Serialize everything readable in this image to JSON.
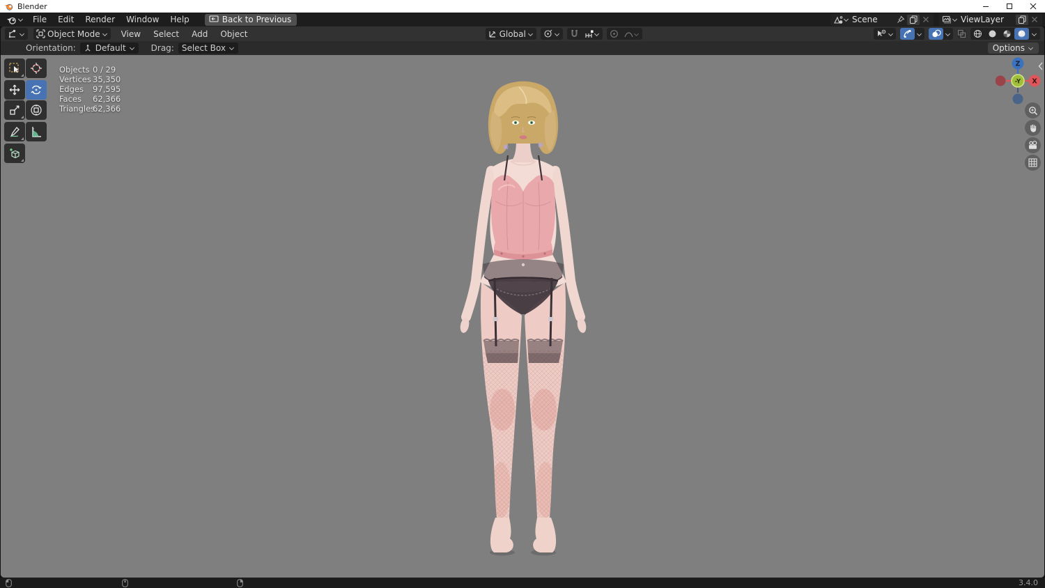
{
  "titlebar": {
    "title": "Blender"
  },
  "topbar": {
    "menus": [
      "File",
      "Edit",
      "Render",
      "Window",
      "Help"
    ],
    "back_button": "Back to Previous",
    "scene": {
      "value": "Scene"
    },
    "viewlayer": {
      "value": "ViewLayer"
    }
  },
  "viewport_header": {
    "mode": "Object Mode",
    "menus": [
      "View",
      "Select",
      "Add",
      "Object"
    ],
    "orientation": "Global"
  },
  "tool_settings": {
    "orientation_label": "Orientation:",
    "orientation_value": "Default",
    "drag_label": "Drag:",
    "drag_value": "Select Box",
    "options": "Options"
  },
  "stats": {
    "rows": [
      {
        "label": "Objects",
        "value": "0 / 29"
      },
      {
        "label": "Vertices",
        "value": "35,350"
      },
      {
        "label": "Edges",
        "value": "97,595"
      },
      {
        "label": "Faces",
        "value": "62,366"
      },
      {
        "label": "Triangles",
        "value": "62,366"
      }
    ]
  },
  "toolbar": {
    "tools": [
      "select-box",
      "cursor",
      "move",
      "rotate",
      "scale",
      "transform",
      "annotate",
      "measure",
      "add-cube"
    ],
    "active_tool": "rotate"
  },
  "gizmo": {
    "axes": {
      "top": "Z",
      "center": "-Y",
      "right": "X"
    }
  },
  "statusbar": {
    "version": "3.4.0"
  },
  "colors": {
    "accent": "#4772b3",
    "axis_x": "#e0565b",
    "axis_y": "#a6c83e",
    "axis_z": "#3b72c0",
    "viewport_bg": "#7f7f7f"
  }
}
